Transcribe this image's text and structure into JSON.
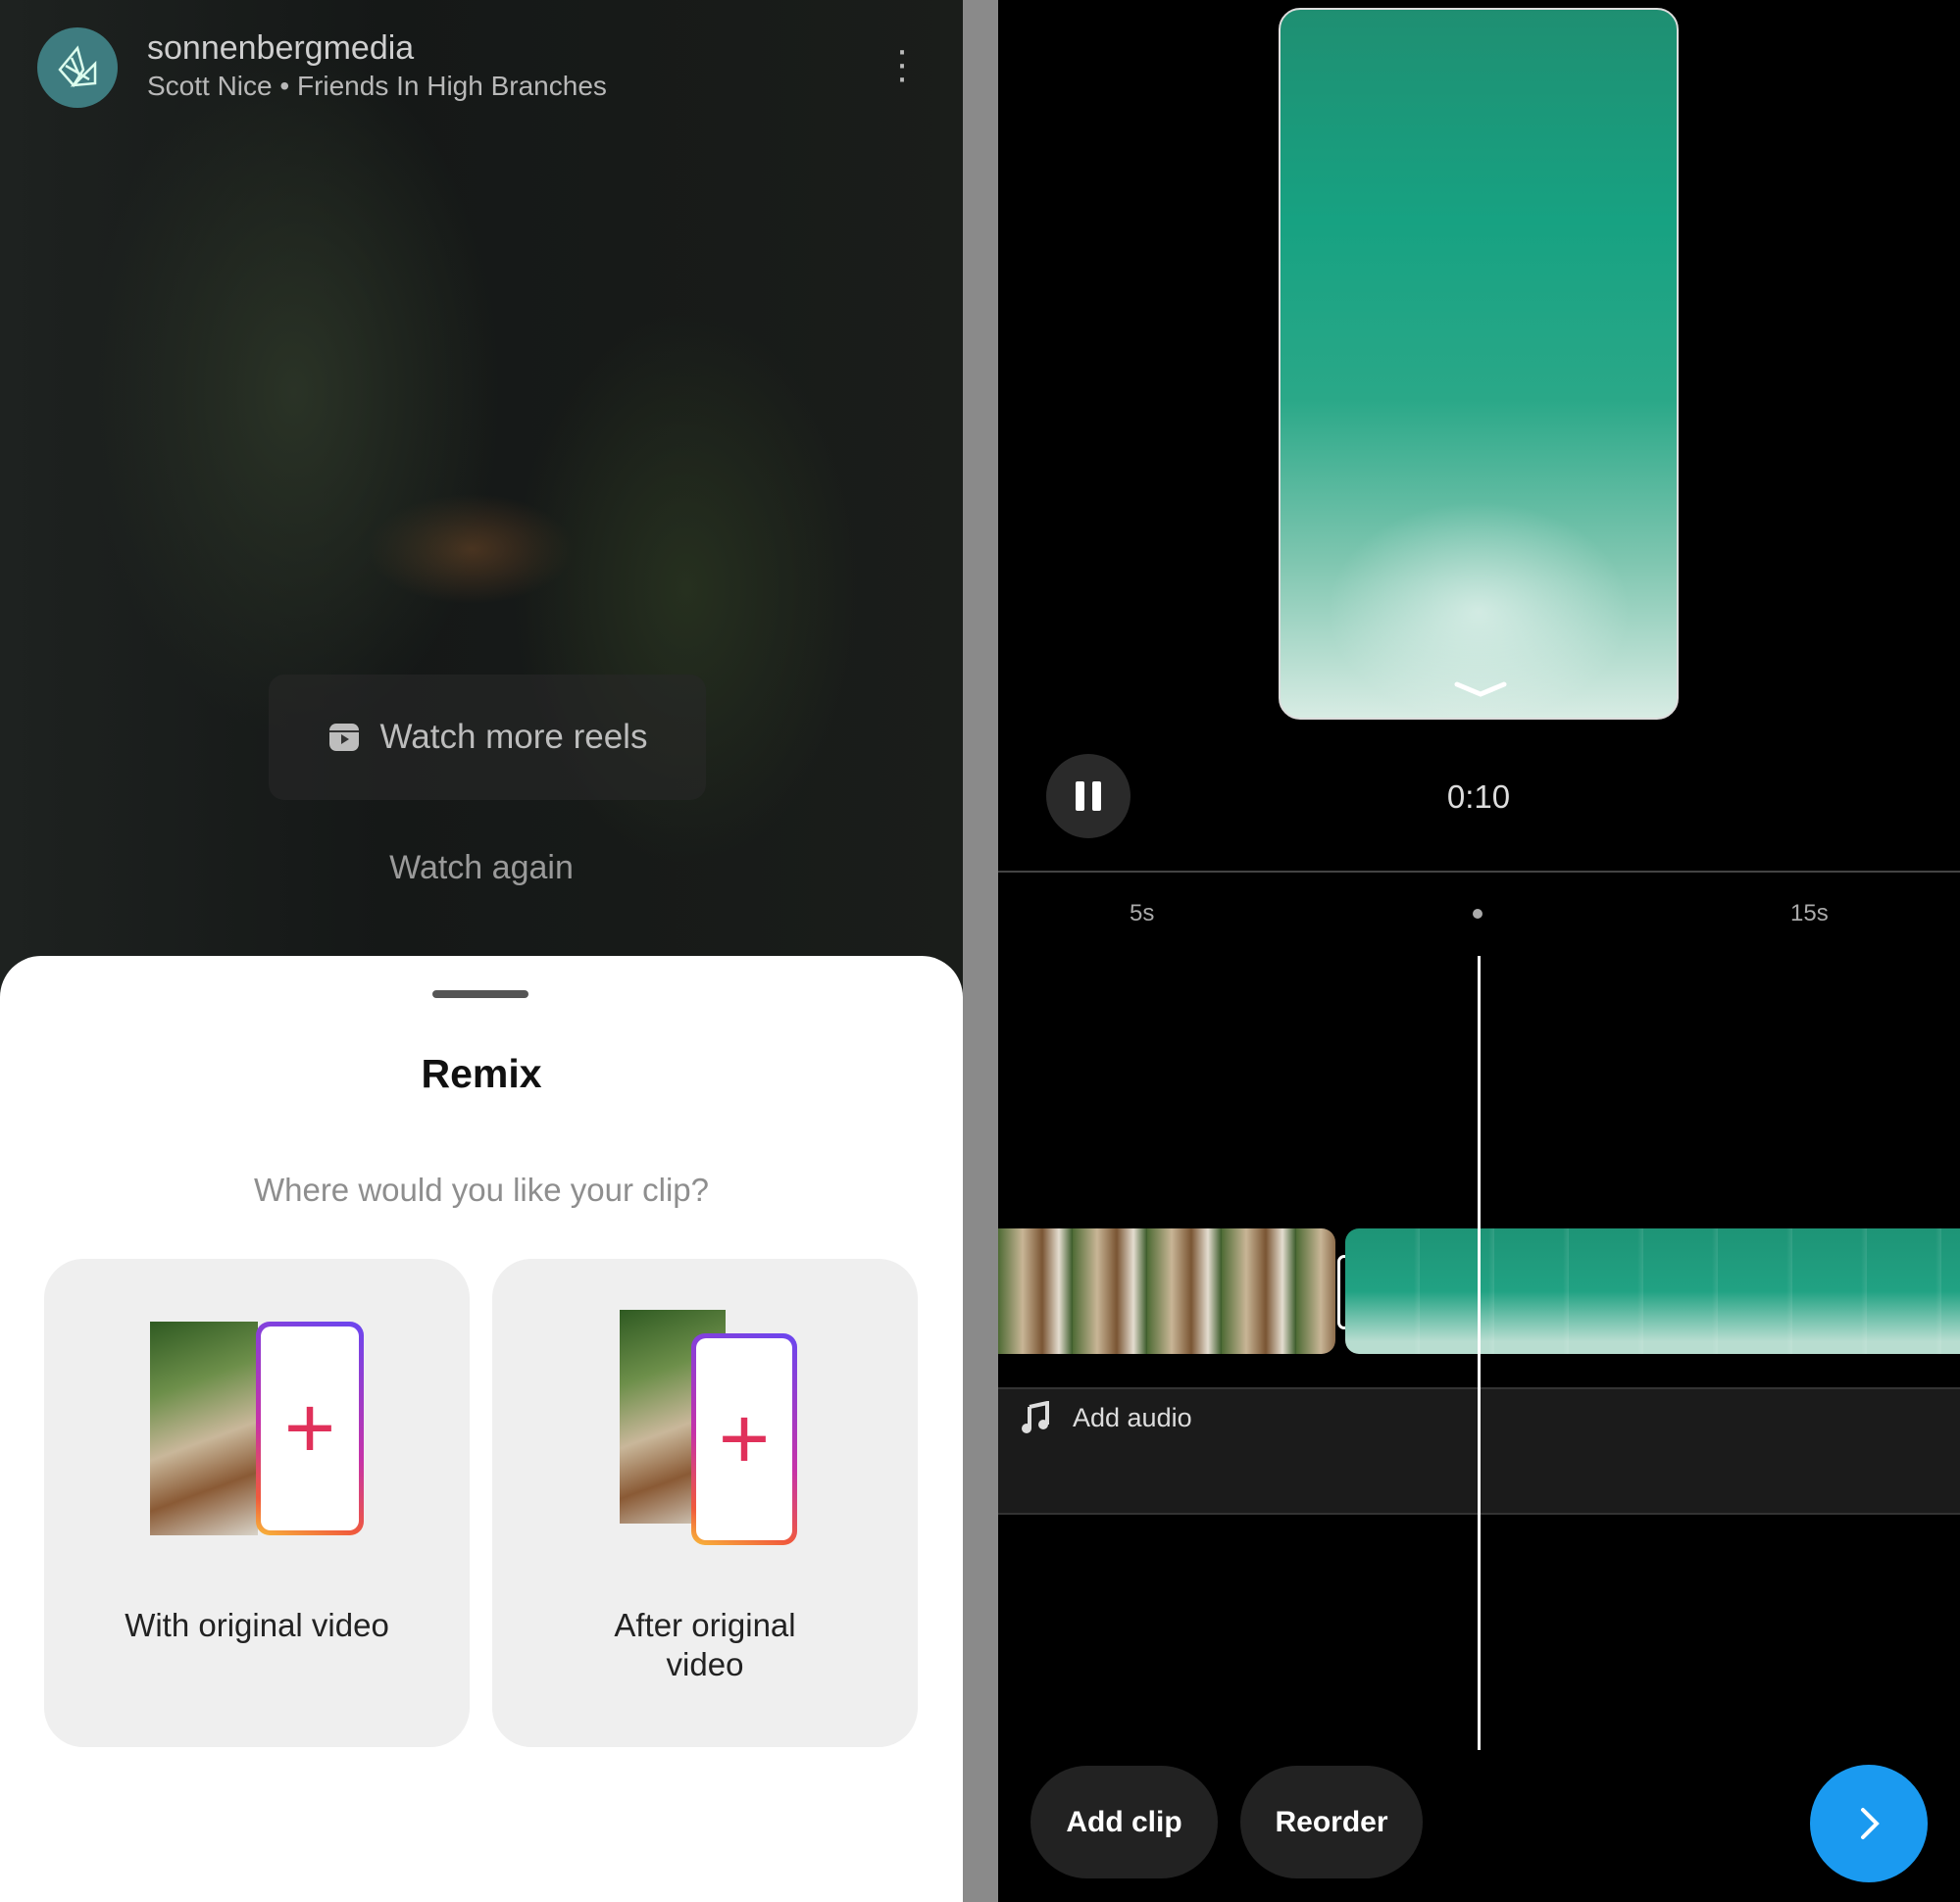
{
  "reel": {
    "username": "sonnenbergmedia",
    "audio_line": "Scott Nice • Friends In High Branches",
    "watch_more": "Watch more reels",
    "watch_again": "Watch again"
  },
  "sheet": {
    "title": "Remix",
    "question": "Where would you like your clip?",
    "options": [
      {
        "label": "With original video"
      },
      {
        "label": "After original video"
      }
    ]
  },
  "editor": {
    "time": "0:10",
    "ticks": [
      "5s",
      "15s"
    ],
    "add_audio": "Add audio",
    "add_clip": "Add clip",
    "reorder": "Reorder"
  },
  "colors": {
    "accent": "#1a9af0",
    "plus": "#e0305a"
  }
}
